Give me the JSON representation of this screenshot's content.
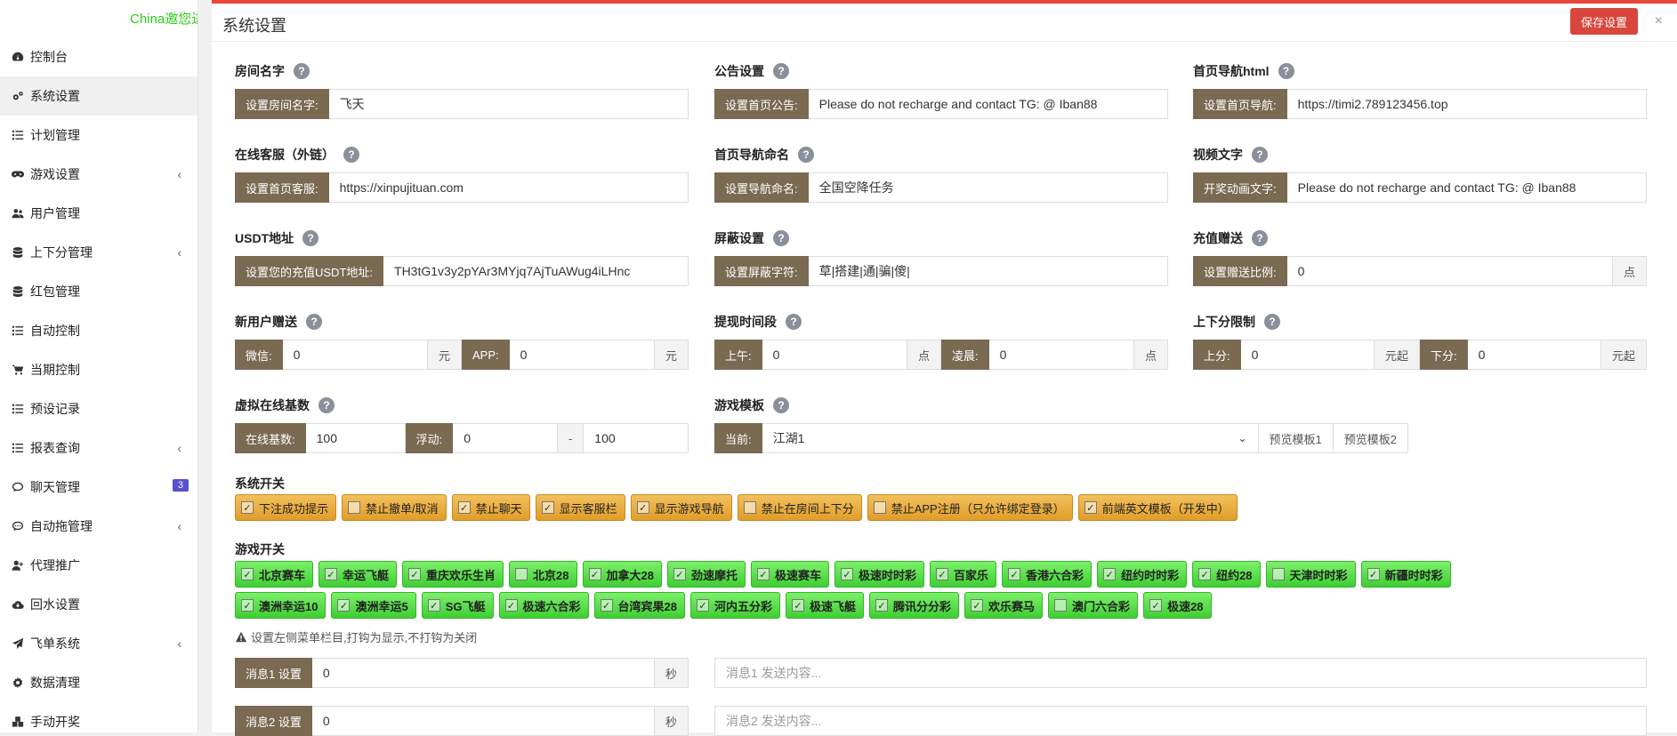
{
  "sidebar": {
    "brand": "China邀您进入",
    "items": [
      {
        "label": "控制台",
        "icon": "dashboard-icon",
        "chevron": "",
        "badge": ""
      },
      {
        "label": "系统设置",
        "icon": "gears-icon",
        "chevron": "",
        "badge": ""
      },
      {
        "label": "计划管理",
        "icon": "list-icon",
        "chevron": "",
        "badge": ""
      },
      {
        "label": "游戏设置",
        "icon": "gamepad-icon",
        "chevron": "‹",
        "badge": ""
      },
      {
        "label": "用户管理",
        "icon": "users-icon",
        "chevron": "",
        "badge": ""
      },
      {
        "label": "上下分管理",
        "icon": "database-icon",
        "chevron": "‹",
        "badge": ""
      },
      {
        "label": "红包管理",
        "icon": "database-icon",
        "chevron": "",
        "badge": ""
      },
      {
        "label": "自动控制",
        "icon": "list-icon",
        "chevron": "",
        "badge": ""
      },
      {
        "label": "当期控制",
        "icon": "cart-icon",
        "chevron": "",
        "badge": ""
      },
      {
        "label": "预设记录",
        "icon": "list-icon",
        "chevron": "",
        "badge": ""
      },
      {
        "label": "报表查询",
        "icon": "list-icon",
        "chevron": "‹",
        "badge": ""
      },
      {
        "label": "聊天管理",
        "icon": "chat-icon",
        "chevron": "",
        "badge": "3"
      },
      {
        "label": "自动拖管理",
        "icon": "comment-icon",
        "chevron": "‹",
        "badge": ""
      },
      {
        "label": "代理推广",
        "icon": "user-plus-icon",
        "chevron": "",
        "badge": ""
      },
      {
        "label": "回水设置",
        "icon": "cloud-icon",
        "chevron": "",
        "badge": ""
      },
      {
        "label": "飞单系统",
        "icon": "send-icon",
        "chevron": "‹",
        "badge": ""
      },
      {
        "label": "数据清理",
        "icon": "gear-icon",
        "chevron": "",
        "badge": ""
      },
      {
        "label": "手动开奖",
        "icon": "cubes-icon",
        "chevron": "",
        "badge": ""
      }
    ]
  },
  "header": {
    "title": "系统设置",
    "save_label": "保存设置",
    "close": "×"
  },
  "fields": {
    "room_name": {
      "label": "房间名字",
      "addon": "设置房间名字:",
      "value": "飞天"
    },
    "announcement": {
      "label": "公告设置",
      "addon": "设置首页公告:",
      "value": "Please do not recharge and contact TG: @ Iban88"
    },
    "nav_html": {
      "label": "首页导航html",
      "addon": "设置首页导航:",
      "value": "https://timi2.789123456.top"
    },
    "service": {
      "label": "在线客服（外链）",
      "addon": "设置首页客服:",
      "value": "https://xinpujituan.com"
    },
    "nav_name": {
      "label": "首页导航命名",
      "addon": "设置导航命名:",
      "value": "全国空降任务"
    },
    "video_text": {
      "label": "视频文字",
      "addon": "开奖动画文字:",
      "value": "Please do not recharge and contact TG: @ Iban88"
    },
    "usdt": {
      "label": "USDT地址",
      "addon": "设置您的充值USDT地址:",
      "value": "TH3tG1v3y2pYAr3MYjq7AjTuAWug4iLHnc"
    },
    "block": {
      "label": "屏蔽设置",
      "addon": "设置屏蔽字符:",
      "value": "草|搭建|通|骗|傻|"
    },
    "recharge_bonus": {
      "label": "充值赠送",
      "addon": "设置赠送比例:",
      "value": "0",
      "suffix": "点"
    },
    "new_user": {
      "label": "新用户赠送",
      "wechat_addon": "微信:",
      "wechat_value": "0",
      "wechat_suffix": "元",
      "app_addon": "APP:",
      "app_value": "0",
      "app_suffix": "元"
    },
    "withdraw_time": {
      "label": "提现时间段",
      "am_addon": "上午:",
      "am_value": "0",
      "am_suffix": "点",
      "early_addon": "凌晨:",
      "early_value": "0",
      "early_suffix": "点"
    },
    "limit": {
      "label": "上下分限制",
      "up_addon": "上分:",
      "up_value": "0",
      "up_suffix": "元起",
      "down_addon": "下分:",
      "down_value": "0",
      "down_suffix": "元起"
    },
    "virtual_online": {
      "label": "虚拟在线基数",
      "base_addon": "在线基数:",
      "base_value": "100",
      "float_addon": "浮动:",
      "float_min": "0",
      "dash": "-",
      "float_max": "100"
    },
    "template": {
      "label": "游戏模板",
      "addon": "当前:",
      "value": "江湖1",
      "preview1": "预览模板1",
      "preview2": "预览模板2"
    }
  },
  "system_switches": {
    "label": "系统开关",
    "items": [
      {
        "label": "下注成功提示",
        "checked": "✓"
      },
      {
        "label": "禁止撤单/取消",
        "checked": ""
      },
      {
        "label": "禁止聊天",
        "checked": "✓"
      },
      {
        "label": "显示客服栏",
        "checked": "✓"
      },
      {
        "label": "显示游戏导航",
        "checked": "✓"
      },
      {
        "label": "禁止在房间上下分",
        "checked": ""
      },
      {
        "label": "禁止APP注册（只允许绑定登录）",
        "checked": ""
      },
      {
        "label": "前端英文模板（开发中）",
        "checked": "✓"
      }
    ]
  },
  "game_switches": {
    "label": "游戏开关",
    "row1": [
      {
        "label": "北京赛车",
        "checked": "✓"
      },
      {
        "label": "幸运飞艇",
        "checked": "✓"
      },
      {
        "label": "重庆欢乐生肖",
        "checked": "✓"
      },
      {
        "label": "北京28",
        "checked": ""
      },
      {
        "label": "加拿大28",
        "checked": "✓"
      },
      {
        "label": "劲速摩托",
        "checked": "✓"
      },
      {
        "label": "极速赛车",
        "checked": "✓"
      },
      {
        "label": "极速时时彩",
        "checked": "✓"
      },
      {
        "label": "百家乐",
        "checked": "✓"
      },
      {
        "label": "香港六合彩",
        "checked": "✓"
      },
      {
        "label": "纽约时时彩",
        "checked": "✓"
      },
      {
        "label": "纽约28",
        "checked": "✓"
      },
      {
        "label": "天津时时彩",
        "checked": ""
      },
      {
        "label": "新疆时时彩",
        "checked": "✓"
      }
    ],
    "row2": [
      {
        "label": "澳洲幸运10",
        "checked": "✓"
      },
      {
        "label": "澳洲幸运5",
        "checked": "✓"
      },
      {
        "label": "SG飞艇",
        "checked": "✓"
      },
      {
        "label": "极速六合彩",
        "checked": "✓"
      },
      {
        "label": "台湾宾果28",
        "checked": "✓"
      },
      {
        "label": "河内五分彩",
        "checked": "✓"
      },
      {
        "label": "极速飞艇",
        "checked": "✓"
      },
      {
        "label": "腾讯分分彩",
        "checked": "✓"
      },
      {
        "label": "欢乐赛马",
        "checked": "✓"
      },
      {
        "label": "澳门六合彩",
        "checked": ""
      },
      {
        "label": "极速28",
        "checked": "✓"
      }
    ],
    "hint": "设置左侧菜单栏目,打钩为显示,不打钩为关闭"
  },
  "messages": [
    {
      "addon": "消息1 设置",
      "value": "0",
      "suffix": "秒",
      "placeholder": "消息1 发送内容..."
    },
    {
      "addon": "消息2 设置",
      "value": "0",
      "suffix": "秒",
      "placeholder": "消息2 发送内容..."
    }
  ],
  "colors": {
    "accent": "#e9453b",
    "addon": "#7a6a52",
    "green": "#4fdc3f",
    "orange": "#e8a83a",
    "brand": "#2ecc1a",
    "badge": "#5a4fcf"
  }
}
